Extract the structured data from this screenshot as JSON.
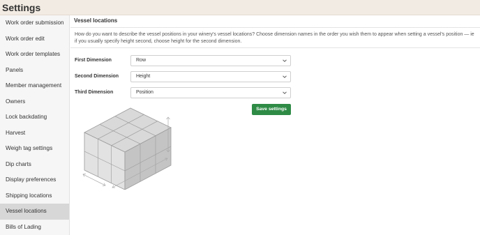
{
  "header": {
    "title": "Settings"
  },
  "sidebar": {
    "items": [
      {
        "label": "Work order submission",
        "active": false
      },
      {
        "label": "Work order edit",
        "active": false
      },
      {
        "label": "Work order templates",
        "active": false
      },
      {
        "label": "Panels",
        "active": false
      },
      {
        "label": "Member management",
        "active": false
      },
      {
        "label": "Owners",
        "active": false
      },
      {
        "label": "Lock backdating",
        "active": false
      },
      {
        "label": "Harvest",
        "active": false
      },
      {
        "label": "Weigh tag settings",
        "active": false
      },
      {
        "label": "Dip charts",
        "active": false
      },
      {
        "label": "Display preferences",
        "active": false
      },
      {
        "label": "Shipping locations",
        "active": false
      },
      {
        "label": "Vessel locations",
        "active": true
      },
      {
        "label": "Bills of Lading",
        "active": false
      }
    ]
  },
  "main": {
    "title": "Vessel locations",
    "description": "How do you want to describe the vessel positions in your winery's vessel locations? Choose dimension names in the order you wish them to appear when setting a vessel's position — ie if you usually specify height second, choose height for the second dimension.",
    "fields": [
      {
        "label": "First Dimension",
        "value": "Row"
      },
      {
        "label": "Second Dimension",
        "value": "Height"
      },
      {
        "label": "Third Dimension",
        "value": "Position"
      }
    ],
    "save_label": "Save settings"
  },
  "colors": {
    "header_bg": "#f2ebe3",
    "sidebar_bg": "#f6f6f6",
    "active_item_bg": "#d7d7d7",
    "primary_button": "#2e8b46"
  },
  "icons": {
    "select_arrow": "chevron-down-icon",
    "illustration": "stacked-cubes-illustration"
  }
}
